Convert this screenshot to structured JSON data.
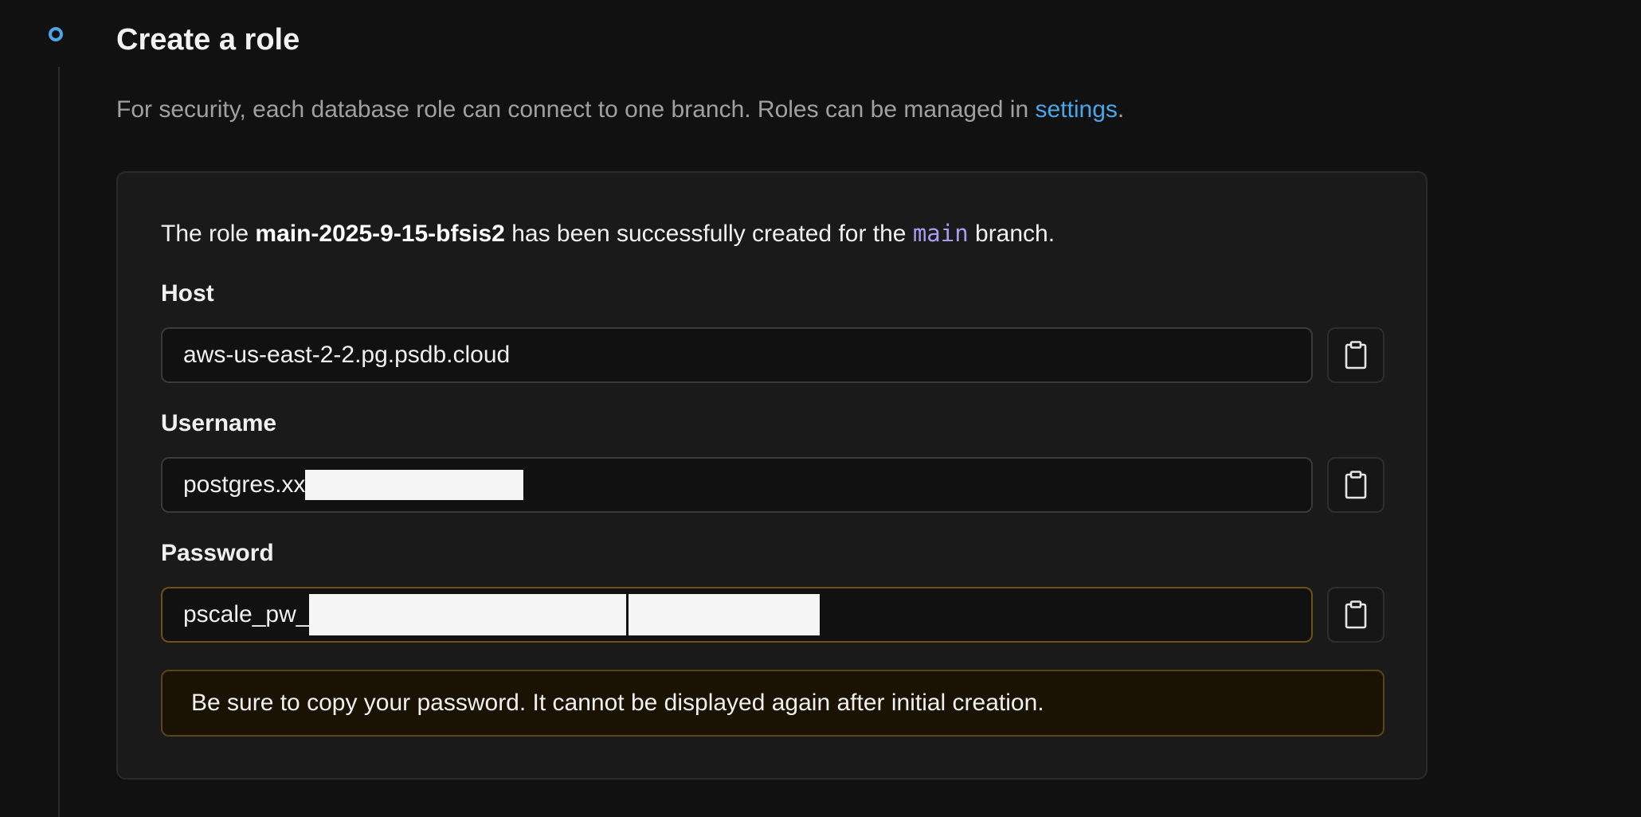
{
  "section": {
    "title": "Create a role",
    "description_prefix": "For security, each database role can connect to one branch. Roles can be managed in ",
    "description_link": "settings",
    "description_suffix": "."
  },
  "card": {
    "msg_prefix": "The role ",
    "role_name": "main-2025-9-15-bfsis2",
    "msg_middle": " has been successfully created for the ",
    "branch": "main",
    "msg_suffix": " branch."
  },
  "fields": {
    "host": {
      "label": "Host",
      "value": "aws-us-east-2-2.pg.psdb.cloud",
      "copy_icon": "clipboard-icon"
    },
    "username": {
      "label": "Username",
      "value": "postgres.xx",
      "copy_icon": "clipboard-icon"
    },
    "password": {
      "label": "Password",
      "value": "pscale_pw_",
      "copy_icon": "clipboard-icon"
    }
  },
  "warning": {
    "text": "Be sure to copy your password. It cannot be displayed again after initial creation."
  },
  "colors": {
    "accent": "#4aa6e8",
    "branch_code": "#a99cf0",
    "warning_border": "#5b4418",
    "warning_bg": "#1a1304"
  }
}
